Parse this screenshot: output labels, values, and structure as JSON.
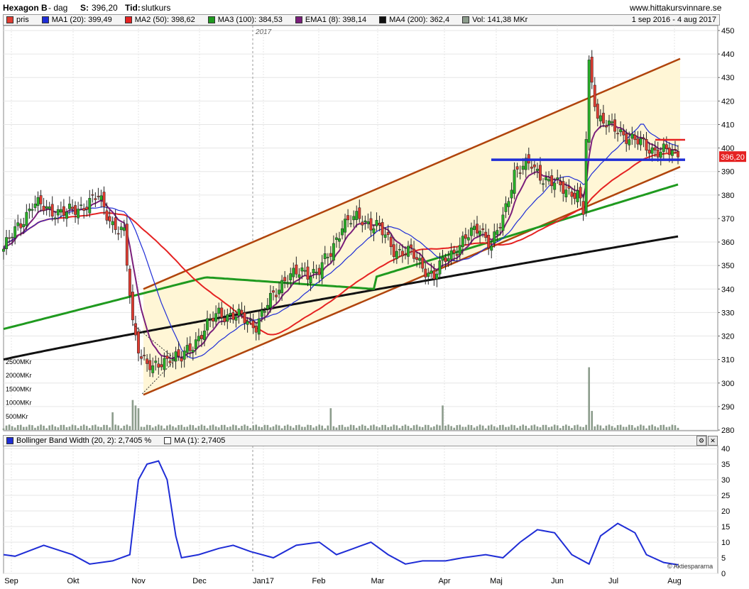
{
  "header": {
    "name": "Hexagon B",
    "period": " - dag",
    "close_label": "S:",
    "close_value": "396,20",
    "type_label": "Tid:",
    "type_value": "slutkurs",
    "site": "www.hittakursvinnare.se"
  },
  "legend": {
    "items": [
      {
        "label": "pris",
        "color": "#e03c31"
      },
      {
        "label": "MA1 (20): 399,49",
        "color": "#1f2dd6"
      },
      {
        "label": "MA2 (50): 398,62",
        "color": "#e52222"
      },
      {
        "label": "MA3 (100): 384,53",
        "color": "#1f9a1f"
      },
      {
        "label": "EMA1 (8): 398,14",
        "color": "#7b1f7b"
      },
      {
        "label": "MA4 (200): 362,4",
        "color": "#111111"
      },
      {
        "label": "Vol: 141,38 MKr",
        "color": "#8c9c8c"
      }
    ],
    "range": "1 sep 2016 - 4 aug 2017"
  },
  "year_marker": "2017",
  "price_tag": "396,20",
  "indicator_legend": {
    "items": [
      {
        "label": "Bollinger Band Width (20, 2): 2,7405  %",
        "color": "#1f2dd6"
      },
      {
        "label": "MA (1): 2,7405",
        "color": "#ffffff"
      }
    ]
  },
  "watermark": "© Aktiespararna",
  "chart_data": [
    {
      "type": "candlestick",
      "title": "Hexagon B - dag",
      "x_labels": [
        "Sep",
        "Okt",
        "Nov",
        "Dec",
        "Jan17",
        "Feb",
        "Mar",
        "Apr",
        "Maj",
        "Jun",
        "Jul",
        "Aug"
      ],
      "y_ticks": [
        280,
        290,
        300,
        310,
        320,
        330,
        340,
        350,
        360,
        370,
        380,
        390,
        400,
        410,
        420,
        430,
        440,
        450
      ],
      "ylim": [
        280,
        450
      ],
      "volume_ticks": [
        "500MKr",
        "1000MKr",
        "1500MKr",
        "2000MKr",
        "2500MKr"
      ],
      "approx_close": [
        {
          "x": "Sep",
          "y": 357
        },
        {
          "x": "mid Sep",
          "y": 376
        },
        {
          "x": "Okt",
          "y": 372
        },
        {
          "x": "mid Okt",
          "y": 378
        },
        {
          "x": "late Okt",
          "y": 365
        },
        {
          "x": "Nov",
          "y": 316
        },
        {
          "x": "mid Nov",
          "y": 312
        },
        {
          "x": "Dec",
          "y": 327
        },
        {
          "x": "mid Dec",
          "y": 328
        },
        {
          "x": "Jan17",
          "y": 345
        },
        {
          "x": "mid Jan",
          "y": 347
        },
        {
          "x": "Feb",
          "y": 368
        },
        {
          "x": "mid Feb",
          "y": 368
        },
        {
          "x": "Mar",
          "y": 356
        },
        {
          "x": "mid Mar",
          "y": 348
        },
        {
          "x": "Apr",
          "y": 365
        },
        {
          "x": "mid Apr",
          "y": 362
        },
        {
          "x": "Maj",
          "y": 392
        },
        {
          "x": "mid Maj",
          "y": 385
        },
        {
          "x": "Jun",
          "y": 373
        },
        {
          "x": "early Jun",
          "y": 440
        },
        {
          "x": "mid Jun",
          "y": 410
        },
        {
          "x": "Jul",
          "y": 404
        },
        {
          "x": "mid Jul",
          "y": 399
        },
        {
          "x": "Aug",
          "y": 396.2
        }
      ],
      "series": [
        {
          "name": "MA1 (20)",
          "last": 399.49
        },
        {
          "name": "MA2 (50)",
          "last": 398.62
        },
        {
          "name": "MA3 (100)",
          "last": 384.53
        },
        {
          "name": "EMA1 (8)",
          "last": 398.14
        },
        {
          "name": "MA4 (200)",
          "last": 362.4
        }
      ],
      "annotations": {
        "resistance_blue": 395,
        "resistance_red": 403.5,
        "channel_upper": [
          {
            "x": "Nov",
            "y": 340
          },
          {
            "x": "Aug",
            "y": 438
          }
        ],
        "channel_lower": [
          {
            "x": "Nov",
            "y": 295
          },
          {
            "x": "Aug",
            "y": 392
          }
        ]
      }
    },
    {
      "type": "line",
      "title": "Bollinger Band Width (20, 2)",
      "y_ticks": [
        0,
        5,
        10,
        15,
        20,
        25,
        30,
        35,
        40
      ],
      "ylim": [
        0,
        40
      ],
      "approx_values": [
        {
          "x": "Sep",
          "y": 6
        },
        {
          "x": "mid Sep",
          "y": 9
        },
        {
          "x": "Okt",
          "y": 3
        },
        {
          "x": "late Okt",
          "y": 5
        },
        {
          "x": "Nov",
          "y": 35
        },
        {
          "x": "late Nov",
          "y": 5
        },
        {
          "x": "Dec",
          "y": 7
        },
        {
          "x": "mid Dec",
          "y": 9
        },
        {
          "x": "Jan17",
          "y": 5
        },
        {
          "x": "mid Jan",
          "y": 10
        },
        {
          "x": "Feb",
          "y": 6
        },
        {
          "x": "mid Feb",
          "y": 10
        },
        {
          "x": "Mar",
          "y": 4
        },
        {
          "x": "mid Mar",
          "y": 5
        },
        {
          "x": "Apr",
          "y": 6
        },
        {
          "x": "mid Apr",
          "y": 6
        },
        {
          "x": "Maj",
          "y": 13
        },
        {
          "x": "late Maj",
          "y": 6
        },
        {
          "x": "Jun",
          "y": 3
        },
        {
          "x": "mid Jun",
          "y": 16
        },
        {
          "x": "Jul",
          "y": 12
        },
        {
          "x": "mid Jul",
          "y": 6
        },
        {
          "x": "Aug",
          "y": 2.74
        }
      ],
      "last": 2.7405
    }
  ]
}
